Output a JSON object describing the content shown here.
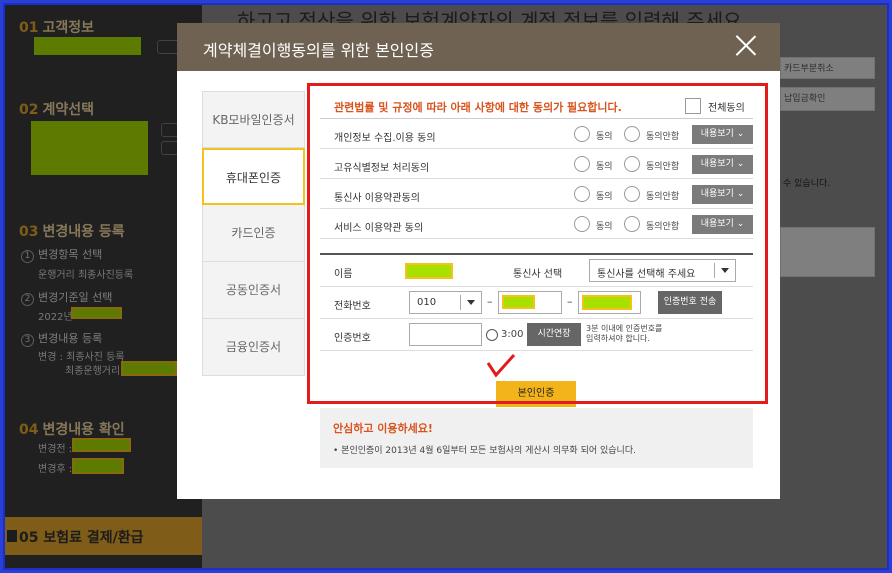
{
  "sidebar": {
    "step1": {
      "num": "01",
      "label": "고객정보"
    },
    "step2": {
      "num": "02",
      "label": "계약선택"
    },
    "step3": {
      "num": "03",
      "label": "변경내용 등록"
    },
    "sub1": {
      "num": "1",
      "label": "변경항목 선택",
      "detail": "운행거리 최종사진등록"
    },
    "sub2": {
      "num": "2",
      "label": "변경기준일 선택",
      "detail": "2022년"
    },
    "sub3": {
      "num": "3",
      "label": "변경내용 등록",
      "detail1": "변경 : 최종사진 등록",
      "detail2": "최종운행거리"
    },
    "step4": {
      "num": "04",
      "label": "변경내용 확인"
    },
    "before": "변경전 :",
    "after": "변경후 :",
    "step5": {
      "num": "05",
      "label": "보험료 결제/환급"
    }
  },
  "background": {
    "title": "하고고 정산을 위한 보험계약자의 계정 정보를 입력해 주세요",
    "right1": "카드부분취소",
    "right2": "납입금확인",
    "right3": "수 있습니다."
  },
  "modal": {
    "title": "계약체결이행동의를 위한 본인인증",
    "tabs": [
      "KB모바일인증서",
      "휴대폰인증",
      "카드인증",
      "공동인증서",
      "금융인증서"
    ],
    "consent_title": "관련법률 및 규정에 따라 아래 사항에 대한 동의가 필요합니다.",
    "all_agree": "전체동의",
    "agree": "동의",
    "disagree": "동의안함",
    "more": "내용보기",
    "consents": [
      "개인정보 수집.이용 동의",
      "고유식별정보 처리동의",
      "통신사 이용약관동의",
      "서비스 이용약관 동의"
    ],
    "form": {
      "name_label": "이름",
      "carrier_label": "통신사 선택",
      "carrier_placeholder": "통신사를 선택해 주세요",
      "phone_label": "전화번호",
      "phone_prefix": "010",
      "send_btn": "인증번호 전송",
      "code_label": "인증번호",
      "timer": "3:00",
      "extend_btn": "시간연장",
      "note1": "3분 이내에 인증번호를",
      "note2": "입력하셔야 합니다."
    },
    "verify_btn": "본인인증",
    "info_title": "안심하고 이용하세요!",
    "info_text": "• 본인인증이 2013년 4월 6일부터 모든 보험사의 게산시 의무화 되어 있습니다."
  },
  "colors": {
    "accent": "#e7a82b",
    "header": "#6f6252",
    "highlight": "#e21b1b"
  }
}
